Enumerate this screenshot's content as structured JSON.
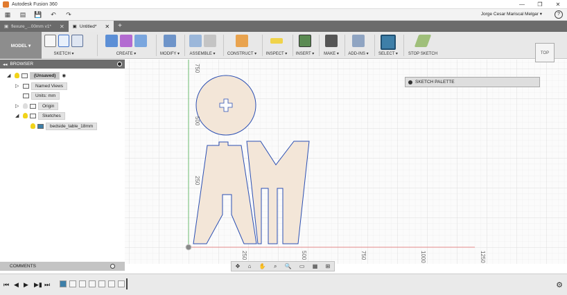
{
  "window": {
    "title": "Autodesk Fusion 360",
    "controls": [
      "—",
      "❐",
      "✕"
    ]
  },
  "menubar": {
    "user": "Jorge Cesar Mariscal Melgar ▾",
    "help": "?"
  },
  "tabs": [
    {
      "label": "flexure_...00mm v1*"
    },
    {
      "label": "Untitled*"
    }
  ],
  "toolbar": {
    "workspace": "MODEL ▾",
    "groups": [
      {
        "label": "SKETCH ▾"
      },
      {
        "label": "CREATE ▾"
      },
      {
        "label": "MODIFY ▾"
      },
      {
        "label": "ASSEMBLE ▾"
      },
      {
        "label": "CONSTRUCT ▾"
      },
      {
        "label": "INSPECT ▾"
      },
      {
        "label": "INSERT ▾"
      },
      {
        "label": "MAKE ▾"
      },
      {
        "label": "ADD-INS ▾"
      },
      {
        "label": "SELECT ▾"
      },
      {
        "label": "STOP SKETCH"
      }
    ]
  },
  "browser": {
    "title": "BROWSER",
    "root": "(Unsaved)",
    "items": [
      "Named Views",
      "Units: mm",
      "Origin",
      "Sketches"
    ],
    "sketch": "bedside_table_18mm"
  },
  "palette": {
    "title": "SKETCH PALETTE"
  },
  "viewcube": {
    "face": "TOP"
  },
  "comments": {
    "title": "COMMENTS"
  },
  "axes": {
    "vertical_ticks": [
      "750",
      "500",
      "250"
    ],
    "horizontal_ticks": [
      "250",
      "500",
      "750",
      "1000",
      "1250"
    ]
  },
  "colors": {
    "sketch_fill": "#f3e6d8",
    "sketch_line": "#2b4fb3",
    "x_axis": "#e06666",
    "grid": "#e3e3e3"
  }
}
